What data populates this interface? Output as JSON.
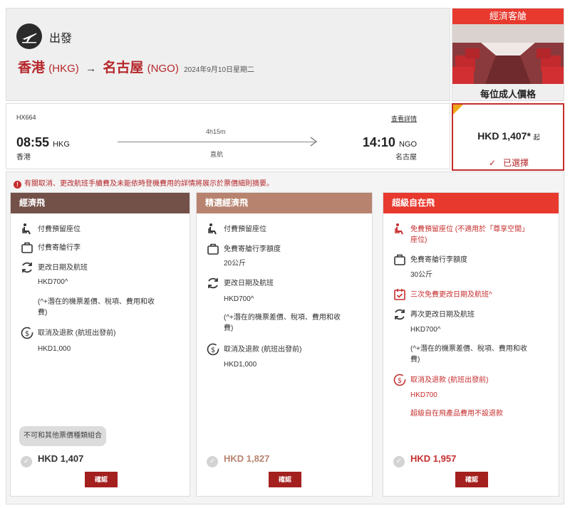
{
  "header": {
    "depart_label": "出發",
    "origin_city": "香港",
    "origin_code": "(HKG)",
    "arrow": "→",
    "dest_city": "名古屋",
    "dest_code": "(NGO)",
    "date": "2024年9月10日星期二"
  },
  "cabin": {
    "title": "經濟客艙",
    "subtitle": "每位成人價格"
  },
  "flight": {
    "number": "HX664",
    "dep_time": "08:55",
    "dep_code": "HKG",
    "dep_city": "香港",
    "duration": "4h15m",
    "stops": "直航",
    "details_link": "查看詳情",
    "arr_time": "14:10",
    "arr_code": "NGO",
    "arr_city": "名古屋"
  },
  "price_box": {
    "amount": "HKD 1,407*",
    "from": "起",
    "selected": "已選擇"
  },
  "notice": "有關取消、更改航班手續費及未能依時登機費用的詳情將展示於票價細則摘要。",
  "colors": {
    "economy_head": "#735149",
    "premium_head": "#b7836f",
    "super_head": "#e8392e",
    "accent_red": "#c62d2d"
  },
  "fares": [
    {
      "name": "經濟飛",
      "seat": "付費預留座位",
      "bag": "付費寄艙行李",
      "change": "更改日期及航班",
      "change_fee": "HKD700^",
      "change_note_1": "(^+潛在的機票差價、稅項、費用和收",
      "change_note_2": "費)",
      "cancel": "取消及退款 (航班出發前)",
      "cancel_fee": "HKD1,000",
      "no_combine": "不可和其他票價種類組合",
      "price": "HKD 1,407",
      "confirm": "確認"
    },
    {
      "name": "精選經濟飛",
      "seat": "付費預留座位",
      "bag": "免費寄艙行李額度",
      "bag_weight": "20公斤",
      "change": "更改日期及航班",
      "change_fee": "HKD700^",
      "change_note_1": "(^+潛在的機票差價、稅項、費用和收",
      "change_note_2": "費)",
      "cancel": "取消及退款 (航班出發前)",
      "cancel_fee": "HKD1,000",
      "price": "HKD 1,827",
      "confirm": "確認"
    },
    {
      "name": "超級自在飛",
      "seat_1": "免費預留座位 (不適用於「尊享空間」",
      "seat_2": "座位)",
      "bag": "免費寄艙行李額度",
      "bag_weight": "30公斤",
      "free_change": "三次免費更改日期及航班^",
      "change": "再次更改日期及航班",
      "change_fee": "HKD700^",
      "change_note_1": "(^+潛在的機票差價、稅項、費用和收",
      "change_note_2": "費)",
      "cancel": "取消及退款 (航班出發前)",
      "cancel_fee": "HKD700",
      "no_refund": "超級自在飛產品費用不設退款",
      "price": "HKD 1,957",
      "confirm": "確認"
    }
  ]
}
